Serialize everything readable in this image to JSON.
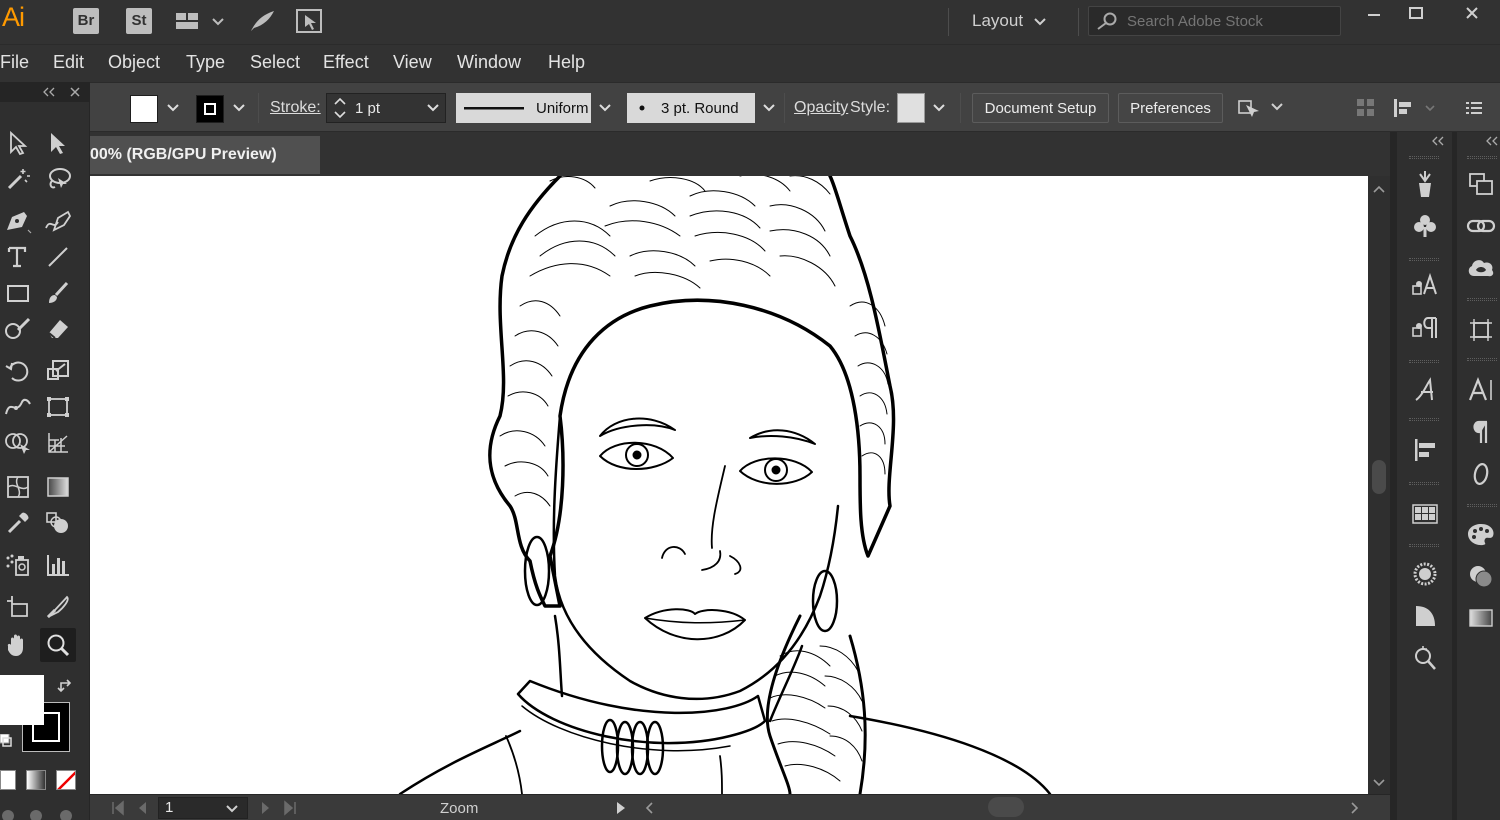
{
  "app": {
    "logo": "Ai",
    "bridge_label": "Br",
    "stock_label": "St"
  },
  "workspace": {
    "label": "Layout"
  },
  "search": {
    "placeholder": "Search Adobe Stock"
  },
  "menu": {
    "items": [
      "File",
      "Edit",
      "Object",
      "Type",
      "Select",
      "Effect",
      "View",
      "Window",
      "Help"
    ]
  },
  "control_bar": {
    "stroke_label": "Stroke:",
    "stroke_weight": "1 pt",
    "profile": "Uniform",
    "brush": "3 pt. Round",
    "opacity_label": "Opacity",
    "style_label": "Style:",
    "document_setup": "Document Setup",
    "preferences": "Preferences"
  },
  "document": {
    "tab_title": "00% (RGB/GPU Preview)",
    "close": "×"
  },
  "status_bar": {
    "artboard_number": "1",
    "mode_label": "Zoom"
  },
  "colors": {
    "fill": "#ffffff",
    "stroke": "#000000",
    "accent": "#ff9a00"
  }
}
